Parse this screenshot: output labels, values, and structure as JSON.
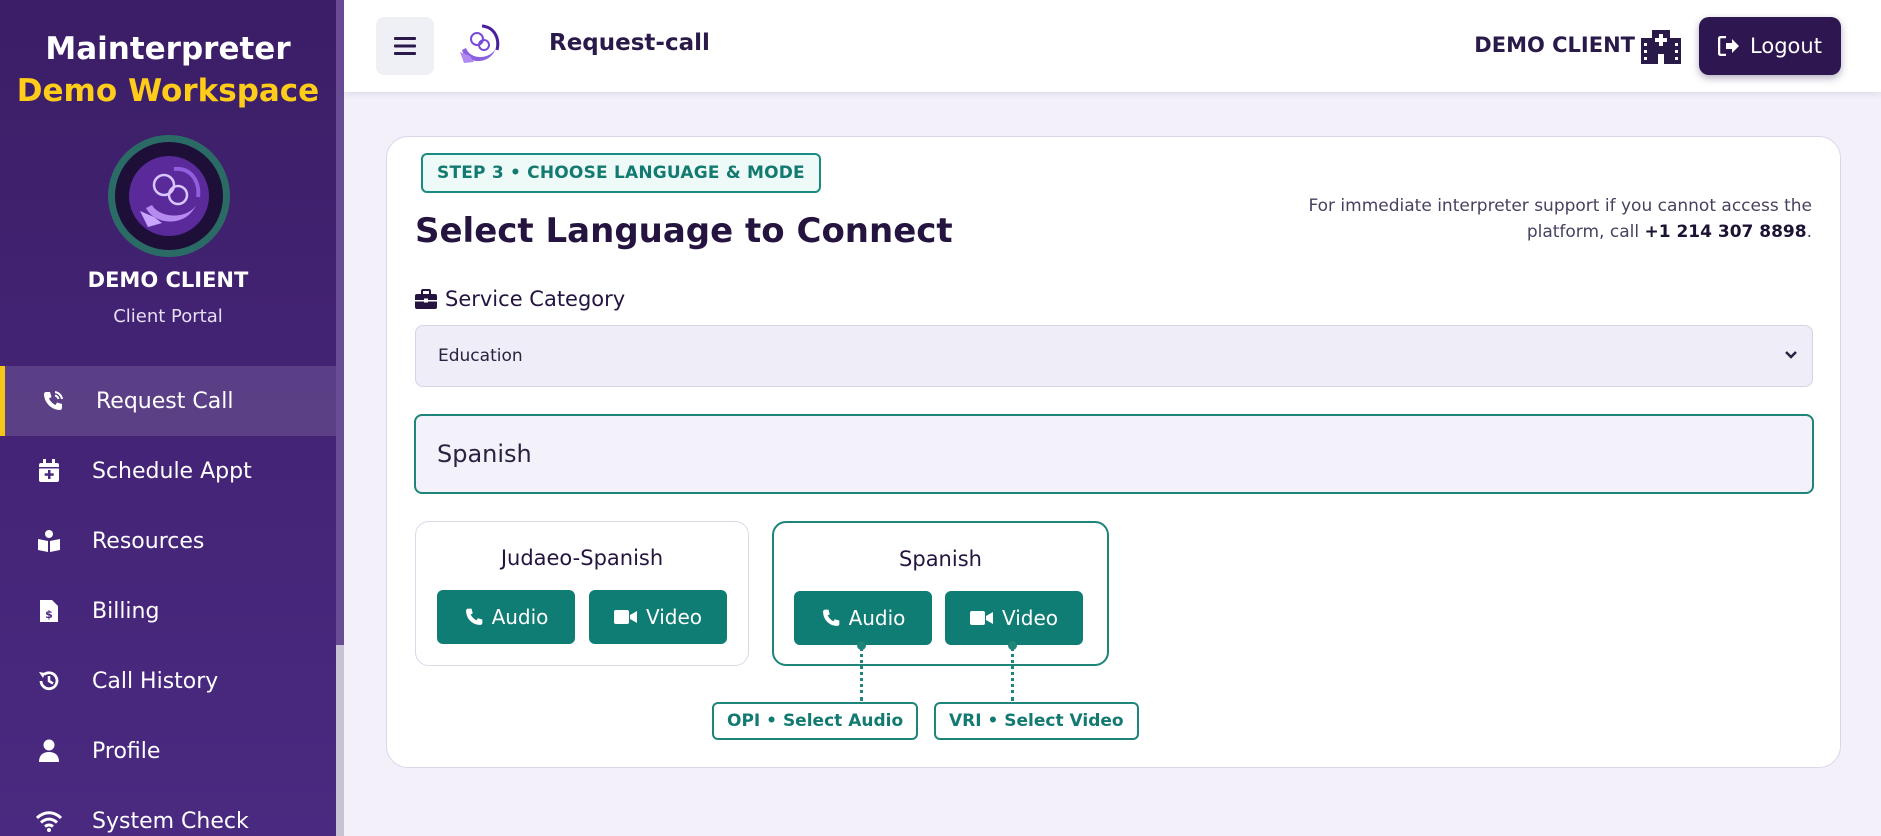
{
  "sidebar": {
    "brand_line1": "Mainterpreter",
    "brand_line2": "Demo Workspace",
    "client_name": "DEMO CLIENT",
    "client_subtitle": "Client Portal",
    "items": [
      {
        "label": "Request Call",
        "icon": "phone-volume-icon",
        "active": true
      },
      {
        "label": "Schedule Appt",
        "icon": "calendar-plus-icon"
      },
      {
        "label": "Resources",
        "icon": "book-reader-icon"
      },
      {
        "label": "Billing",
        "icon": "invoice-dollar-icon"
      },
      {
        "label": "Call History",
        "icon": "history-icon"
      },
      {
        "label": "Profile",
        "icon": "user-icon"
      },
      {
        "label": "System Check",
        "icon": "wifi-icon"
      }
    ]
  },
  "topbar": {
    "title": "Request-call",
    "client_name": "DEMO CLIENT",
    "logout_label": "Logout"
  },
  "main": {
    "step_badge": "STEP 3  •  CHOOSE LANGUAGE & MODE",
    "title": "Select Language to Connect",
    "support_text": "For immediate interpreter support if you cannot access the platform, call ",
    "support_phone": "+1 214 307 8898",
    "support_end": ".",
    "category_label": "Service Category",
    "category_value": "Education",
    "search_value": "Spanish",
    "languages": [
      {
        "name": "Judaeo-Spanish",
        "audio_label": "Audio",
        "video_label": "Video"
      },
      {
        "name": "Spanish",
        "audio_label": "Audio",
        "video_label": "Video",
        "selected": true
      }
    ],
    "tags": {
      "audio": "OPI  •  Select Audio",
      "video": "VRI  •  Select Video"
    }
  },
  "colors": {
    "sidebar_bg": "#3b1e66",
    "accent_yellow": "#ffcc1a",
    "teal": "#0f7d73",
    "logout_bg": "#2e1650"
  }
}
